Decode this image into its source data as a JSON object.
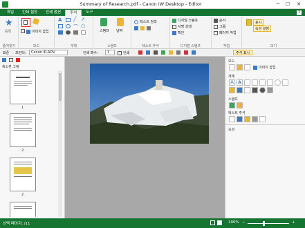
{
  "window": {
    "title": "Summary of Research.pdf - Canon iW Desktop - Editor"
  },
  "menu": {
    "tabs": [
      "파일",
      "인쇄 설정",
      "인쇄 옵션",
      "주석",
      "도구"
    ],
    "active": "주석"
  },
  "ribbon": {
    "groups": [
      "즐겨찾기",
      "모드",
      "개체",
      "스탬프",
      "텍스트 주석",
      "디지털 스탬프",
      "작업",
      "보기"
    ],
    "favorites_label": "등록",
    "mode": {
      "insert_image": "이미지 삽입"
    },
    "stamp_label": "스탬프",
    "date_label": "날짜",
    "text_annotation": {
      "search": "텍스트 검색",
      "btn2": "",
      "btn3": ""
    },
    "digital_stamp": {
      "d_stamp": "디지털 스탬프",
      "signature_status": "서명 상태",
      "confirm": "확인"
    },
    "work": {
      "order": "순서",
      "group": "그룹",
      "page_op": "페이지 작업"
    },
    "view": {
      "show": "표시",
      "attr_setting": "속성 설정"
    }
  },
  "subbar": {
    "scope": "표준",
    "printer_label": "프린터:",
    "printer": "Canon iR-ADV",
    "copies_label": "인쇄 매수:",
    "copies": "1",
    "print_label": "인쇄",
    "show_annotations": "주석 표시"
  },
  "left_panel": {
    "title": "축소판 그림",
    "page_labels": [
      "1",
      "2",
      "2",
      ""
    ]
  },
  "right_panel": {
    "sections": [
      "모드",
      "개체",
      "스탬프",
      "텍스트 주석",
      "속성"
    ],
    "insert_image": "이미지 삽입"
  },
  "status": {
    "page_info": "선택 페이지: /11",
    "zoom": "100%"
  },
  "colors": {
    "brand": "#177532",
    "highlight": "#e2231a"
  }
}
